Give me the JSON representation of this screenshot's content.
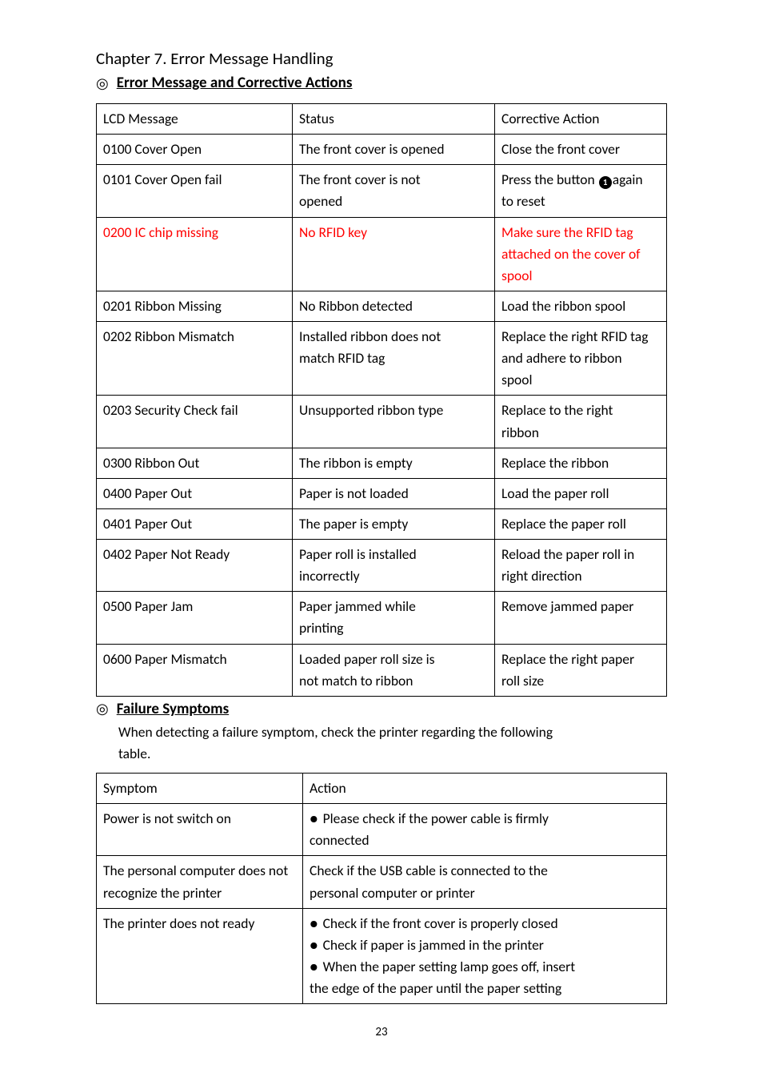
{
  "chapter": {
    "title": "Chapter 7. Error Message Handling"
  },
  "sections": {
    "circle_glyph": "◎",
    "s1_title": "Error Message and Corrective Actions",
    "s2_title": "Failure Symptoms"
  },
  "table1": {
    "h0": "LCD Message",
    "h1": "Status",
    "h2": "Corrective Action",
    "rows": [
      {
        "c0": "0100 Cover Open",
        "c1": "The front cover is opened",
        "c2": "Close the front cover"
      },
      {
        "c0": "0101 Cover Open fail",
        "c1a": "The front cover is not",
        "c1b": "opened",
        "c2a_pre": "Press the button ",
        "c2a_num": "1",
        "c2a_post": "again",
        "c2b": "to reset"
      },
      {
        "c0": "0200 IC chip missing",
        "c1": "No RFID key",
        "c2a": "Make sure the RFID tag",
        "c2b": "attached on the cover of",
        "c2c": "spool",
        "red": true
      },
      {
        "c0": "0201 Ribbon Missing",
        "c1": "No Ribbon detected",
        "c2": "Load the ribbon spool"
      },
      {
        "c0": "0202 Ribbon Mismatch",
        "c1a": "Installed ribbon does not",
        "c1b": "match RFID tag",
        "c2a": "Replace the right RFID tag",
        "c2b": "and adhere to ribbon",
        "c2c": "spool"
      },
      {
        "c0": "0203 Security Check fail",
        "c1": "Unsupported ribbon type",
        "c2a": "Replace to the right",
        "c2b": "ribbon"
      },
      {
        "c0": "0300 Ribbon Out",
        "c1": "The ribbon is empty",
        "c2": "Replace the ribbon"
      },
      {
        "c0": "0400 Paper Out",
        "c1": "Paper is not loaded",
        "c2": "Load the paper roll"
      },
      {
        "c0": "0401 Paper Out",
        "c1": "The paper is empty",
        "c2": "Replace the paper roll"
      },
      {
        "c0": "0402 Paper Not Ready",
        "c1a": "Paper roll is installed",
        "c1b": "incorrectly",
        "c2a": "Reload the paper roll in",
        "c2b": "right direction"
      },
      {
        "c0": "0500 Paper Jam",
        "c1a": "Paper jammed while",
        "c1b": "printing",
        "c2": "Remove jammed paper"
      },
      {
        "c0": "0600 Paper Mismatch",
        "c1a": "Loaded paper roll size is",
        "c1b": "not match to ribbon",
        "c2a": "Replace the right paper",
        "c2b": "roll size"
      }
    ]
  },
  "s2_para_l1": "When detecting a failure symptom, check the printer regarding the following",
  "s2_para_l2": "table.",
  "table2": {
    "h0": "Symptom",
    "h1": "Action",
    "rows": [
      {
        "c0": "Power is not switch on",
        "b0": "Please check if the power cable is firmly",
        "b0_cont": "connected"
      },
      {
        "c0a": "The personal computer does not",
        "c0b": "recognize the printer",
        "l0": "Check if the USB cable is connected to the",
        "l1": "personal computer or printer"
      },
      {
        "c0": "The printer does not ready",
        "b0": "Check if the front cover is properly closed",
        "b1": "Check if paper is jammed in the printer",
        "b2": "When the paper setting lamp goes off, insert",
        "l3": "the edge of the paper until the paper setting"
      }
    ]
  },
  "bullet": "●",
  "page_number": "23"
}
